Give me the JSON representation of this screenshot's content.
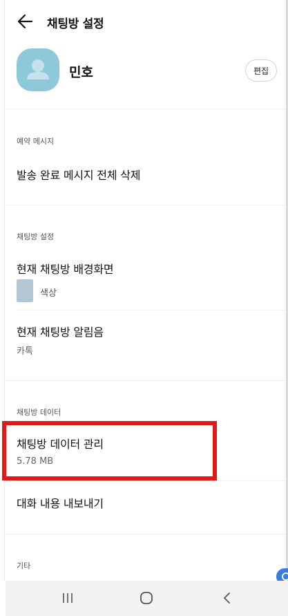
{
  "header": {
    "title": "채팅방 설정",
    "back_icon": "arrow-left-icon"
  },
  "profile": {
    "name": "민호",
    "edit_label": "편집",
    "avatar_color": "#8ec9da"
  },
  "sections": {
    "reserved": {
      "label": "예약 메시지",
      "delete_all": "발송 완료 메시지 전체 삭제"
    },
    "chat_settings": {
      "label": "채팅방 설정",
      "wallpaper_title": "현재 채팅방 배경화면",
      "wallpaper_value": "색상",
      "wallpaper_color": "#b3c6d4",
      "notification_title": "현재 채팅방 알림음",
      "notification_value": "카톡"
    },
    "chat_data": {
      "label": "채팅방 데이터",
      "manage_title": "채팅방 데이터 관리",
      "manage_size": "5.78 MB",
      "export_title": "대화 내용 내보내기"
    },
    "etc": {
      "label": "기타"
    }
  },
  "highlight_color": "#e3181b",
  "navbar": {
    "icons": [
      "recent-apps-icon",
      "home-icon",
      "back-icon"
    ]
  }
}
